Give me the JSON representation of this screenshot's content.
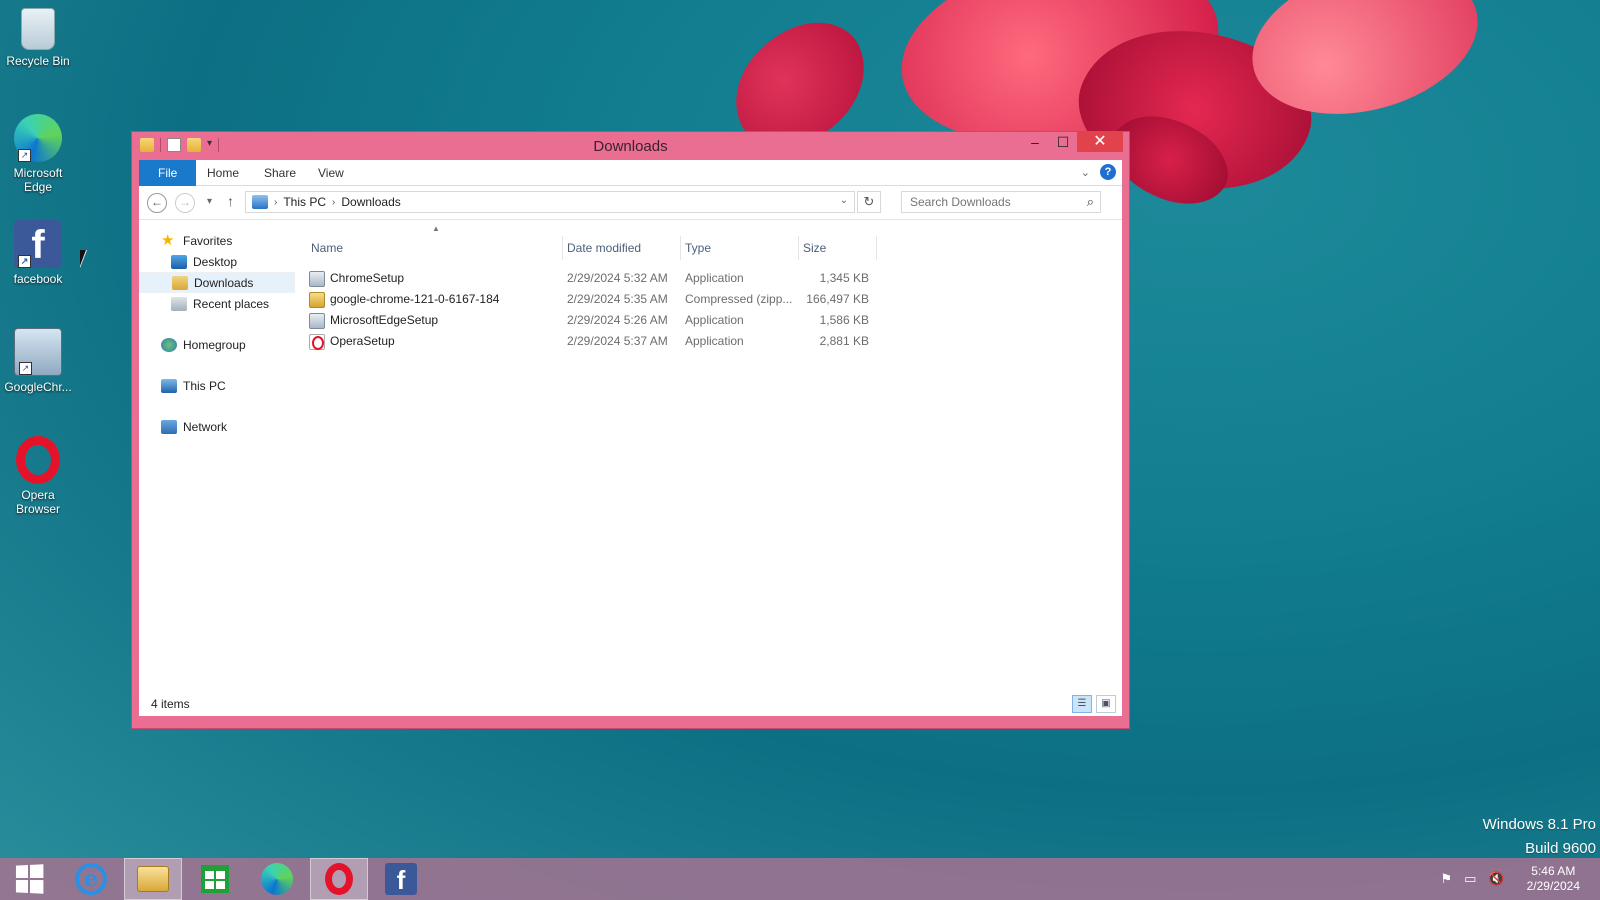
{
  "desktop": {
    "icons": [
      {
        "label": "Recycle Bin",
        "icon": "recycle-bin-icon"
      },
      {
        "label": "Microsoft Edge",
        "icon": "edge-icon"
      },
      {
        "label": "facebook",
        "icon": "facebook-icon"
      },
      {
        "label": "GoogleChr...",
        "icon": "installer-icon"
      },
      {
        "label": "Opera Browser",
        "icon": "opera-icon"
      }
    ],
    "watermark": {
      "line1": "Windows 8.1 Pro",
      "line2": "Build 9600"
    }
  },
  "window": {
    "title": "Downloads",
    "controls": {
      "minimize": "–",
      "maximize": "☐",
      "close": "✕"
    },
    "ribbon": {
      "tabs": {
        "file": "File",
        "home": "Home",
        "share": "Share",
        "view": "View"
      },
      "help": "?"
    },
    "nav": {
      "breadcrumb": [
        "This PC",
        "Downloads"
      ],
      "search_placeholder": "Search Downloads"
    },
    "sidebar": {
      "favorites": "Favorites",
      "desktop": "Desktop",
      "downloads": "Downloads",
      "recent": "Recent places",
      "homegroup": "Homegroup",
      "thispc": "This PC",
      "network": "Network"
    },
    "columns": {
      "name": "Name",
      "date": "Date modified",
      "type": "Type",
      "size": "Size"
    },
    "files": [
      {
        "name": "ChromeSetup",
        "date": "2/29/2024 5:32 AM",
        "type": "Application",
        "size": "1,345 KB",
        "icon": "application-icon"
      },
      {
        "name": "google-chrome-121-0-6167-184",
        "date": "2/29/2024 5:35 AM",
        "type": "Compressed (zipp...",
        "size": "166,497 KB",
        "icon": "zip-folder-icon"
      },
      {
        "name": "MicrosoftEdgeSetup",
        "date": "2/29/2024 5:26 AM",
        "type": "Application",
        "size": "1,586 KB",
        "icon": "application-icon"
      },
      {
        "name": "OperaSetup",
        "date": "2/29/2024 5:37 AM",
        "type": "Application",
        "size": "2,881 KB",
        "icon": "opera-installer-icon"
      }
    ],
    "status": "4 items"
  },
  "taskbar": {
    "apps": [
      "start-icon",
      "internet-explorer-icon",
      "file-explorer-icon",
      "store-icon",
      "edge-icon",
      "opera-icon",
      "facebook-icon"
    ],
    "clock": {
      "time": "5:46 AM",
      "date": "2/29/2024"
    }
  },
  "colors": {
    "window_frame": "#e96e91",
    "file_tab": "#1979ca",
    "close_button": "#e0434b"
  }
}
